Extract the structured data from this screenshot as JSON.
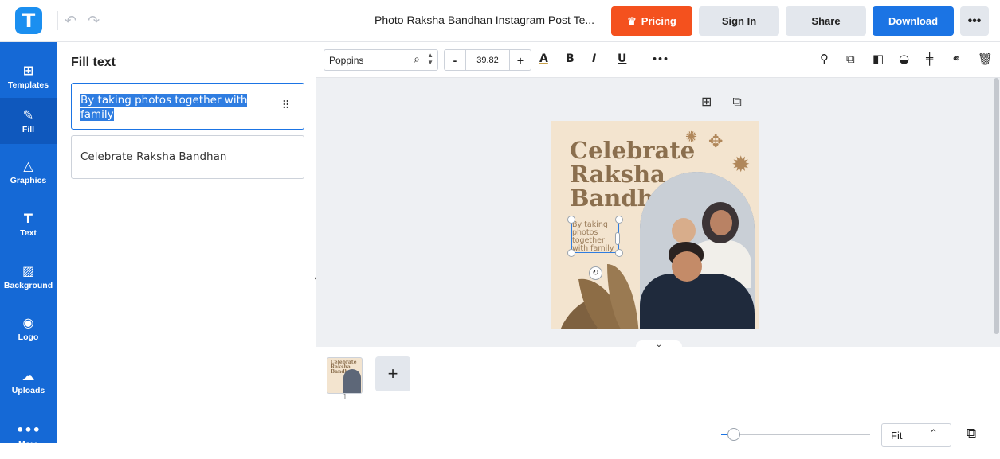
{
  "header": {
    "logo_letter": "T",
    "undo_icon": "undo-icon",
    "redo_icon": "redo-icon",
    "document_title": "Photo Raksha Bandhan Instagram Post Te...",
    "pricing_label": "Pricing",
    "signin_label": "Sign In",
    "share_label": "Share",
    "download_label": "Download",
    "more_label": "•••",
    "pricing_color": "#f4511e",
    "download_color": "#1b74e4"
  },
  "sidebar": {
    "color": "#1569d6",
    "items": [
      {
        "label": "Templates",
        "icon": "templates-icon"
      },
      {
        "label": "Fill",
        "icon": "pencil-icon"
      },
      {
        "label": "Graphics",
        "icon": "shapes-icon"
      },
      {
        "label": "Text",
        "icon": "text-icon"
      },
      {
        "label": "Background",
        "icon": "background-icon"
      },
      {
        "label": "Logo",
        "icon": "logo-icon"
      },
      {
        "label": "Uploads",
        "icon": "upload-cloud-icon"
      },
      {
        "label": "More",
        "icon": "more-icon"
      }
    ]
  },
  "fill_panel": {
    "title": "Fill text",
    "fields": [
      {
        "value": "By taking photos together with family"
      },
      {
        "value": "Celebrate Raksha Bandhan"
      }
    ]
  },
  "toolbar": {
    "font_name": "Poppins",
    "font_size": "39.82",
    "minus_label": "-",
    "plus_label": "+",
    "color_label": "A",
    "bold_label": "B",
    "italic_label": "I",
    "underline_label": "U",
    "more_label": "•••"
  },
  "canvas": {
    "headline": "Celebrate Raksha Bandhan",
    "subtext": "By taking photos together with family",
    "design_background": "#f3e4cf",
    "headline_color": "#8b6f4e"
  },
  "pages": {
    "thumb_text": "Celebrate Raksha Bandhan",
    "page_number": "1",
    "add_label": "+"
  },
  "footer": {
    "zoom_fit": "Fit",
    "zoom_level_percent": 4
  }
}
